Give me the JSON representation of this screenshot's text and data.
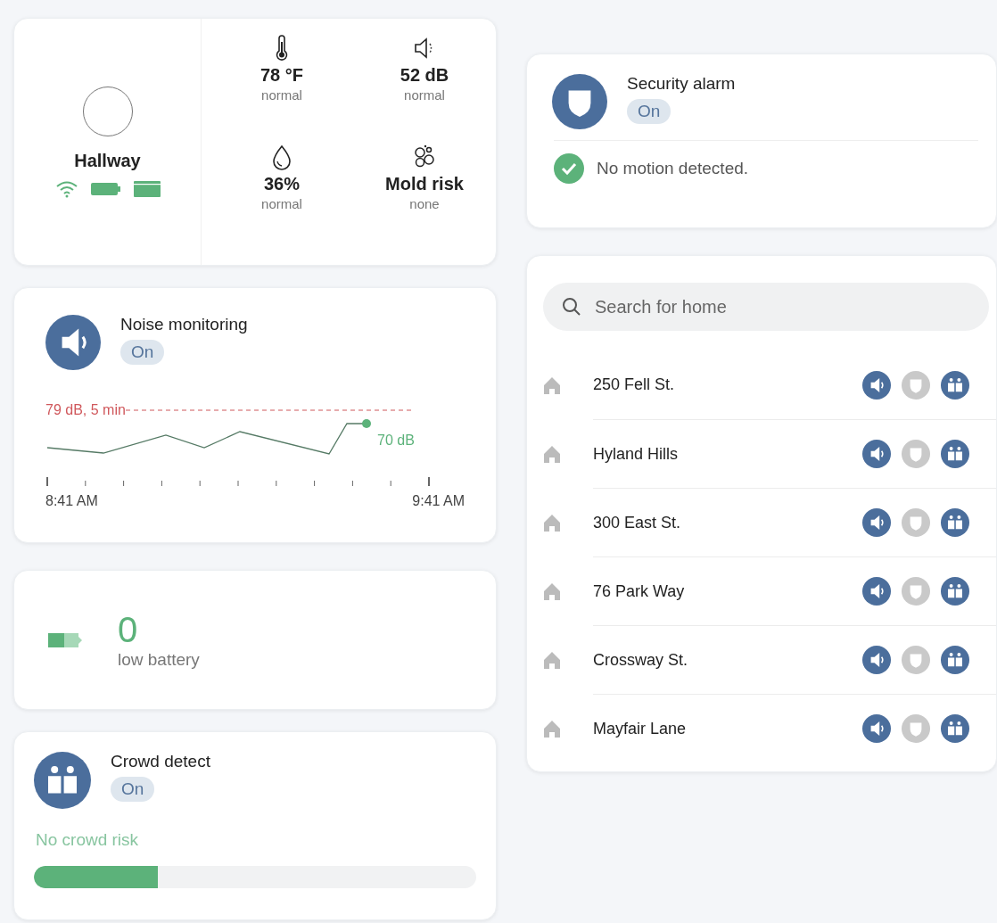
{
  "room": {
    "name": "Hallway",
    "metrics": [
      {
        "kind": "temperature",
        "value": "78 °F",
        "status": "normal"
      },
      {
        "kind": "noise",
        "value": "52 dB",
        "status": "normal"
      },
      {
        "kind": "humidity",
        "value": "36%",
        "status": "normal"
      },
      {
        "kind": "mold",
        "value": "Mold risk",
        "status": "none"
      }
    ]
  },
  "noise_monitoring": {
    "title": "Noise monitoring",
    "status": "On",
    "threshold": "79 dB, 5 min",
    "current": "70 dB",
    "start_time": "8:41 AM",
    "end_time": "9:41 AM"
  },
  "battery": {
    "count": "0",
    "label": "low battery"
  },
  "crowd_detect": {
    "title": "Crowd detect",
    "status": "On",
    "message": "No crowd risk",
    "level": 0.28
  },
  "security_alarm": {
    "title": "Security alarm",
    "status": "On",
    "message": "No motion detected."
  },
  "search": {
    "placeholder": "Search for home"
  },
  "homes": [
    {
      "name": "250 Fell St.",
      "noise": true,
      "alarm": false,
      "crowd": true
    },
    {
      "name": "Hyland Hills",
      "noise": true,
      "alarm": false,
      "crowd": true
    },
    {
      "name": "300 East St.",
      "noise": true,
      "alarm": false,
      "crowd": true
    },
    {
      "name": "76 Park Way",
      "noise": true,
      "alarm": false,
      "crowd": true
    },
    {
      "name": "Crossway St.",
      "noise": true,
      "alarm": false,
      "crowd": true
    },
    {
      "name": "Mayfair Lane",
      "noise": true,
      "alarm": false,
      "crowd": true
    }
  ]
}
